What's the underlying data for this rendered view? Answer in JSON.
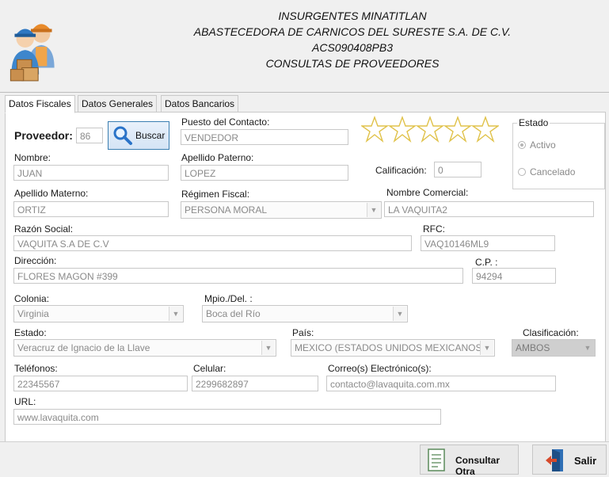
{
  "header": {
    "line1": "INSURGENTES MINATITLAN",
    "line2": "ABASTECEDORA DE CARNICOS DEL SURESTE S.A. DE C.V.",
    "line3": "ACS090408PB3",
    "line4": "CONSULTAS DE PROVEEDORES"
  },
  "tabs": [
    {
      "label": "Datos Fiscales",
      "active": true
    },
    {
      "label": "Datos Generales",
      "active": false
    },
    {
      "label": "Datos Bancarios",
      "active": false
    }
  ],
  "form": {
    "proveedor_label": "Proveedor:",
    "proveedor_value": "86",
    "buscar_label": "Buscar",
    "puesto_label": "Puesto del Contacto:",
    "puesto_value": "VENDEDOR",
    "rating_stars": 5,
    "rating_filled": 0,
    "estado_group_label": "Estado",
    "estado_options": [
      "Activo",
      "Cancelado"
    ],
    "estado_selected": "Activo",
    "nombre_label": "Nombre:",
    "nombre_value": "JUAN",
    "apellido_paterno_label": "Apellido Paterno:",
    "apellido_paterno_value": "LOPEZ",
    "calificacion_label": "Calificación:",
    "calificacion_value": "0",
    "apellido_materno_label": "Apellido Materno:",
    "apellido_materno_value": "ORTIZ",
    "regimen_label": "Régimen Fiscal:",
    "regimen_value": "PERSONA MORAL",
    "nombre_comercial_label": "Nombre Comercial:",
    "nombre_comercial_value": "LA VAQUITA2",
    "razon_social_label": "Razón Social:",
    "razon_social_value": "VAQUITA S.A DE C.V",
    "rfc_label": "RFC:",
    "rfc_value": "VAQ10146ML9",
    "direccion_label": "Dirección:",
    "direccion_value": "FLORES MAGON #399",
    "cp_label": "C.P. :",
    "cp_value": "94294",
    "colonia_label": "Colonia:",
    "colonia_value": "Virginia",
    "mpio_label": "Mpio./Del. :",
    "mpio_value": "Boca del Río",
    "estado_label": "Estado:",
    "estado_value": "Veracruz de Ignacio de la Llave",
    "pais_label": "País:",
    "pais_value": "MEXICO (ESTADOS UNIDOS MEXICANOS)",
    "clasificacion_label": "Clasificación:",
    "clasificacion_value": "AMBOS",
    "telefonos_label": "Teléfonos:",
    "telefonos_value": "22345567",
    "celular_label": "Celular:",
    "celular_value": "2299682897",
    "correo_label": "Correo(s) Electrónico(s):",
    "correo_value": "contacto@lavaquita.com.mx",
    "url_label": "URL:",
    "url_value": "www.lavaquita.com"
  },
  "actions": {
    "consultar_label": "Consultar Otra",
    "salir_label": "Salir"
  }
}
